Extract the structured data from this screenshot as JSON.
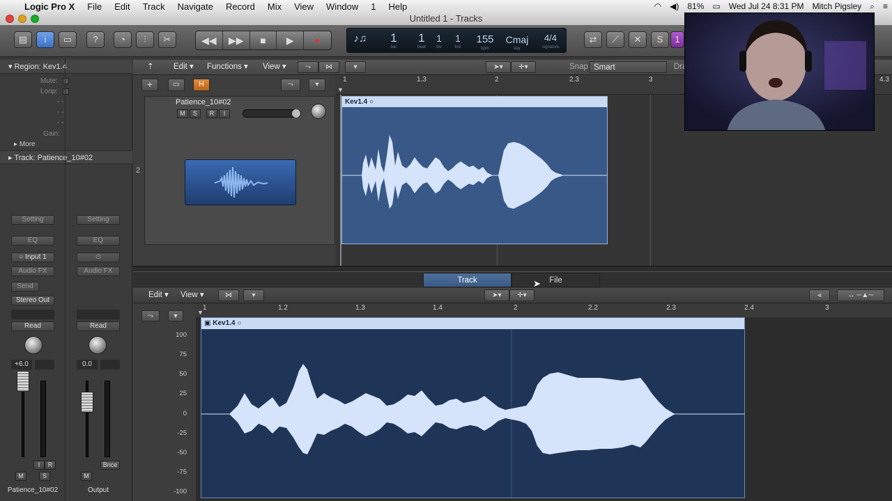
{
  "menubar": {
    "apple_icon": "apple-icon",
    "app_name": "Logic Pro X",
    "items": [
      "File",
      "Edit",
      "Track",
      "Navigate",
      "Record",
      "Mix",
      "View",
      "Window",
      "1",
      "Help"
    ],
    "battery": "81%",
    "datetime": "Wed Jul 24  8:31 PM",
    "user": "Mitch Pigsley"
  },
  "window": {
    "title": "Untitled 1 - Tracks"
  },
  "lcd": {
    "bar": "1",
    "beat": "1",
    "div": "1",
    "tick": "1",
    "bar_label": "bar",
    "beat_label": "beat",
    "div_label": "div",
    "tick_label": "tick",
    "bpm": "155",
    "bpm_label": "bpm",
    "key": "Cmaj",
    "key_label": "key",
    "signature": "4/4",
    "signature_label": "signature"
  },
  "inspector": {
    "region_title": "Region: Kev1.4",
    "mute_label": "Mute:",
    "loop_label": "Loop:",
    "dash1": "- -",
    "dash2": "- -",
    "dash3": "- -",
    "gain_label": "Gain:",
    "more_label": "More",
    "track_title": "Track:  Patience_10#02",
    "channels": [
      {
        "setting": "Setting",
        "eq": "EQ",
        "input": "Input 1",
        "audio_fx": "Audio FX",
        "send": "Send",
        "output": "Stereo Out",
        "automation": "Read",
        "volume": "+6.0",
        "name": "Patience_10#02"
      },
      {
        "setting": "Setting",
        "eq": "EQ",
        "input": "",
        "audio_fx": "Audio FX",
        "send": "",
        "output": "",
        "automation": "Read",
        "volume": "0.0",
        "name": "Output",
        "bounce": "Bnce"
      }
    ]
  },
  "tracks_toolbar": {
    "edit": "Edit",
    "functions": "Functions",
    "view": "View",
    "snap_label": "Snap:",
    "snap_value": "Smart",
    "drag_label": "Dra"
  },
  "track_list": [
    {
      "number": "2",
      "name": "Patience_10#02",
      "m": "M",
      "s": "S",
      "r": "R",
      "i": "I"
    }
  ],
  "ruler_top": [
    "1",
    "1.3",
    "2",
    "2.3",
    "3",
    "4.3"
  ],
  "region_top": {
    "name": "Kev1.4"
  },
  "editor_tabs": [
    "Track",
    "File"
  ],
  "editor_toolbar": {
    "edit": "Edit",
    "view": "View"
  },
  "ruler_bottom": [
    "1",
    "1.2",
    "1.3",
    "1.4",
    "2",
    "2.2",
    "2.3",
    "2.4",
    "3"
  ],
  "region_bottom": {
    "name": "Kev1.4"
  },
  "amplitude_scale": [
    "100",
    "75",
    "50",
    "25",
    "0",
    "-25",
    "-50",
    "-75",
    "-100"
  ],
  "colors": {
    "region_blue": "#385887",
    "region_header": "#c9dbf2",
    "waveform": "#d6e4fb",
    "record_red": "#d23a3a"
  }
}
